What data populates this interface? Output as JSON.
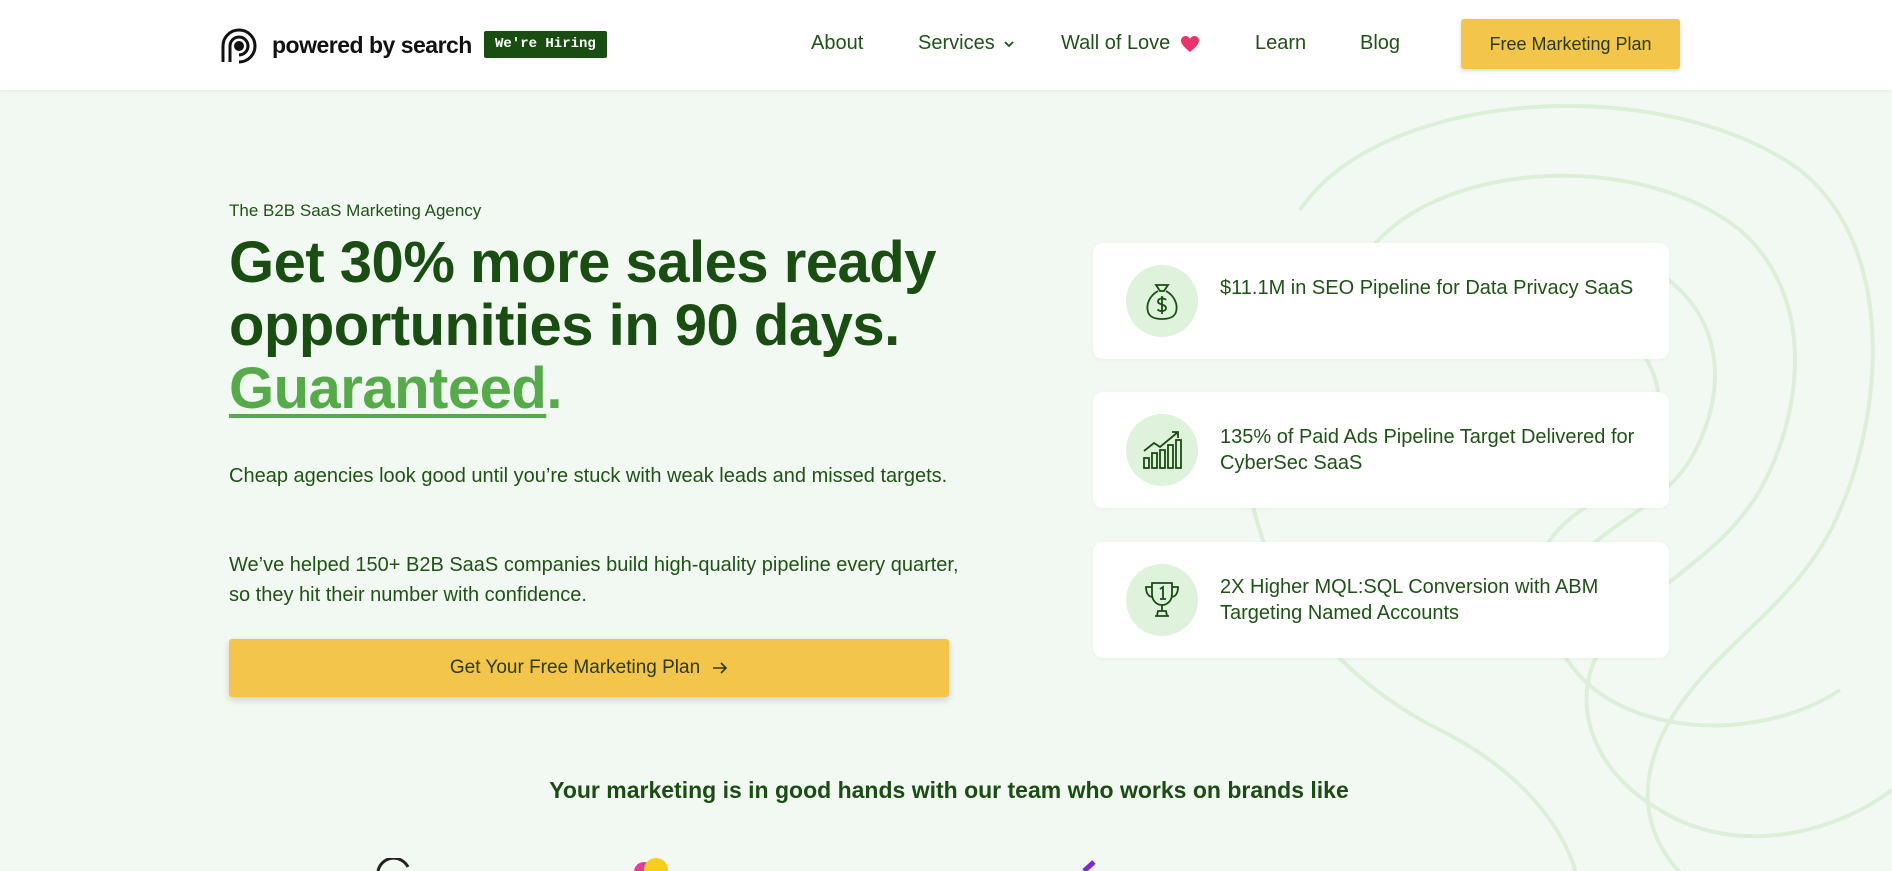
{
  "header": {
    "logo_text": "powered by search",
    "hiring_badge": "We're Hiring",
    "nav": {
      "about": "About",
      "services": "Services",
      "wall_of_love": "Wall of Love",
      "learn": "Learn",
      "blog": "Blog"
    },
    "cta": "Free Marketing Plan"
  },
  "hero": {
    "eyebrow": "The B2B SaaS Marketing Agency",
    "headline_line1": "Get 30% more sales ready",
    "headline_line2": "opportunities in 90 days.",
    "headline_accent": "Guaranteed",
    "headline_period": ".",
    "paragraph1": "Cheap agencies look good until you’re stuck with weak leads and missed targets.",
    "paragraph2": "We’ve helped 150+ B2B SaaS companies build high-quality pipeline every quarter, so they hit their number with confidence.",
    "cta": "Get Your Free Marketing Plan"
  },
  "stats": [
    {
      "icon": "money-bag-icon",
      "text": "$11.1M in SEO Pipeline for Data Privacy SaaS"
    },
    {
      "icon": "growth-chart-icon",
      "text": "135% of Paid Ads Pipeline Target Delivered for CyberSec SaaS"
    },
    {
      "icon": "trophy-icon",
      "text": "2X Higher MQL:SQL Conversion with ABM Targeting Named Accounts"
    }
  ],
  "brands_heading": "Your marketing is in good hands with our team who works on brands like",
  "colors": {
    "primary_green": "#1a4d12",
    "accent_green": "#56aa4a",
    "cta_yellow": "#f3c54a",
    "background": "#f2f9f2",
    "icon_bg": "#dff2dc",
    "heart": "#e8336d"
  }
}
